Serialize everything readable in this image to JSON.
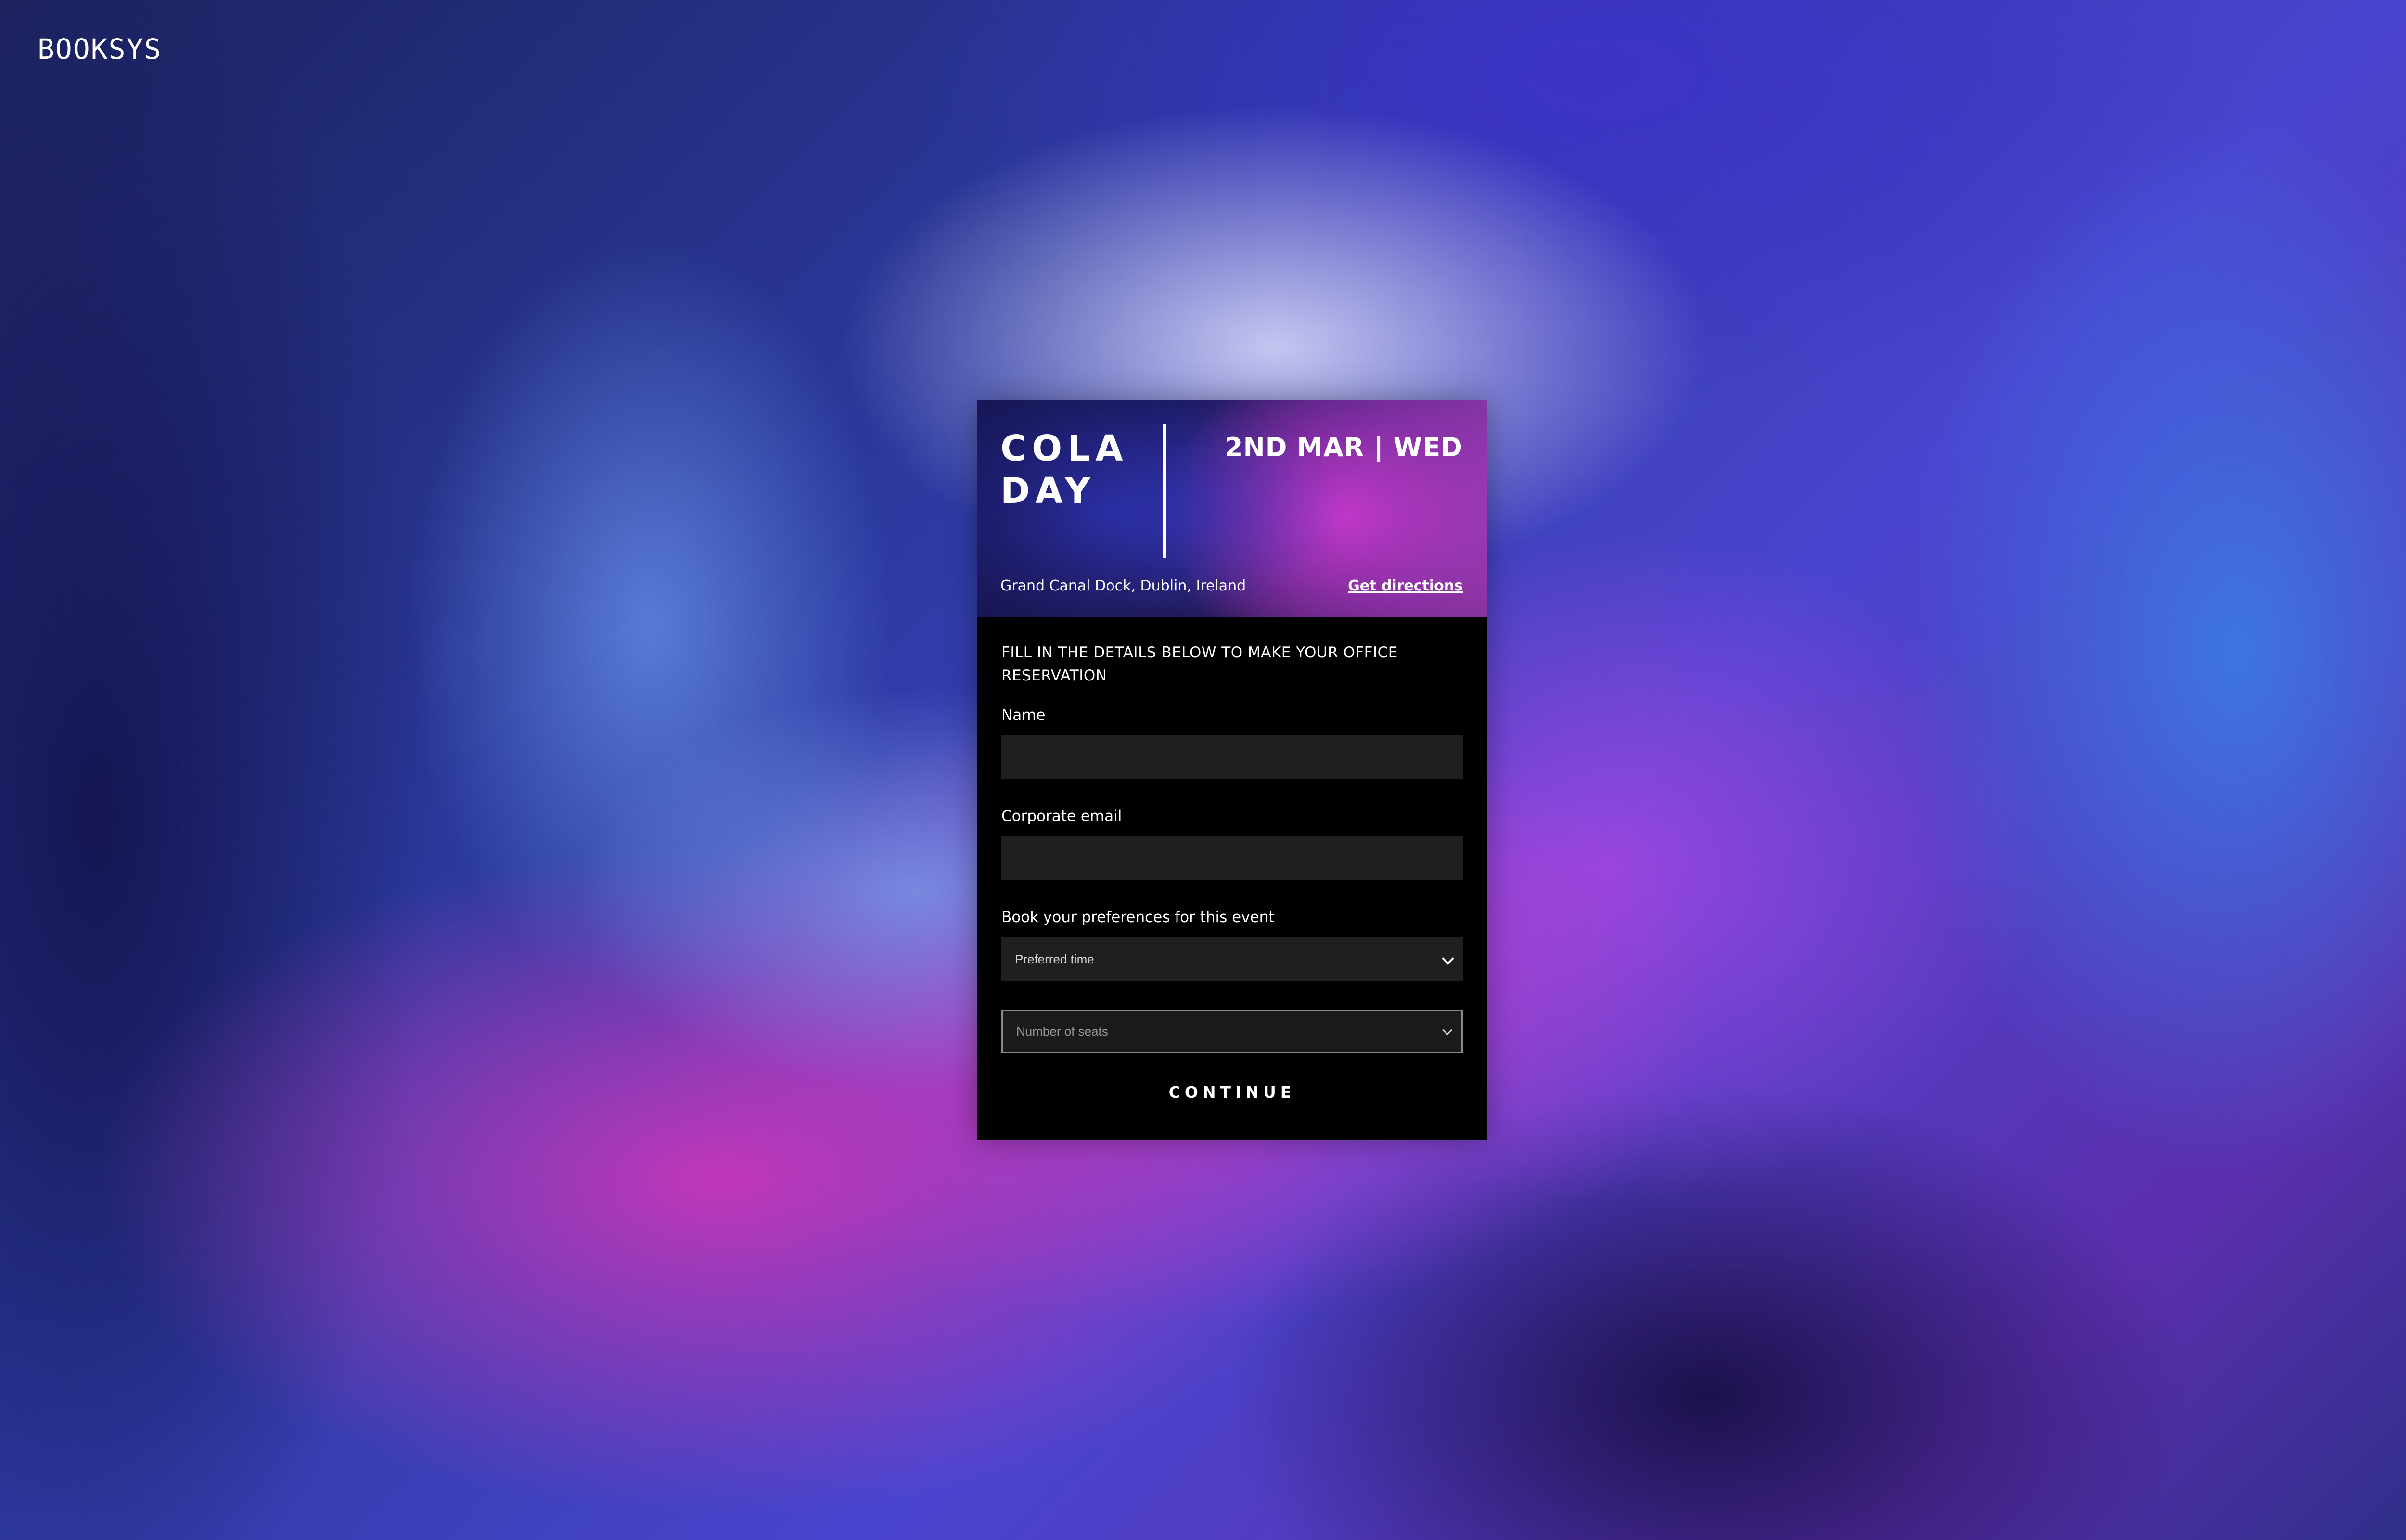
{
  "brand": {
    "logo_text": "BOOKSYS"
  },
  "event": {
    "title_line1": "COLA",
    "title_line2": "DAY",
    "date": "2ND MAR | WED",
    "location": "Grand Canal Dock, Dublin, Ireland",
    "directions_label": "Get directions"
  },
  "form": {
    "heading": "FILL IN THE DETAILS BELOW TO MAKE YOUR OFFICE RESERVATION",
    "name_label": "Name",
    "name_value": "",
    "email_label": "Corporate email",
    "email_value": "",
    "preferences_label": "Book your preferences for this event",
    "preferred_time_placeholder": "Preferred time",
    "seats_placeholder": "Number of seats",
    "continue_label": "CONTINUE"
  },
  "colors": {
    "card_background": "#000000",
    "input_background": "#1f1f1f",
    "text": "#ffffff",
    "banner_accent": "#cd37c8"
  },
  "icons": {
    "select_chevron": "chevron-down-icon"
  }
}
